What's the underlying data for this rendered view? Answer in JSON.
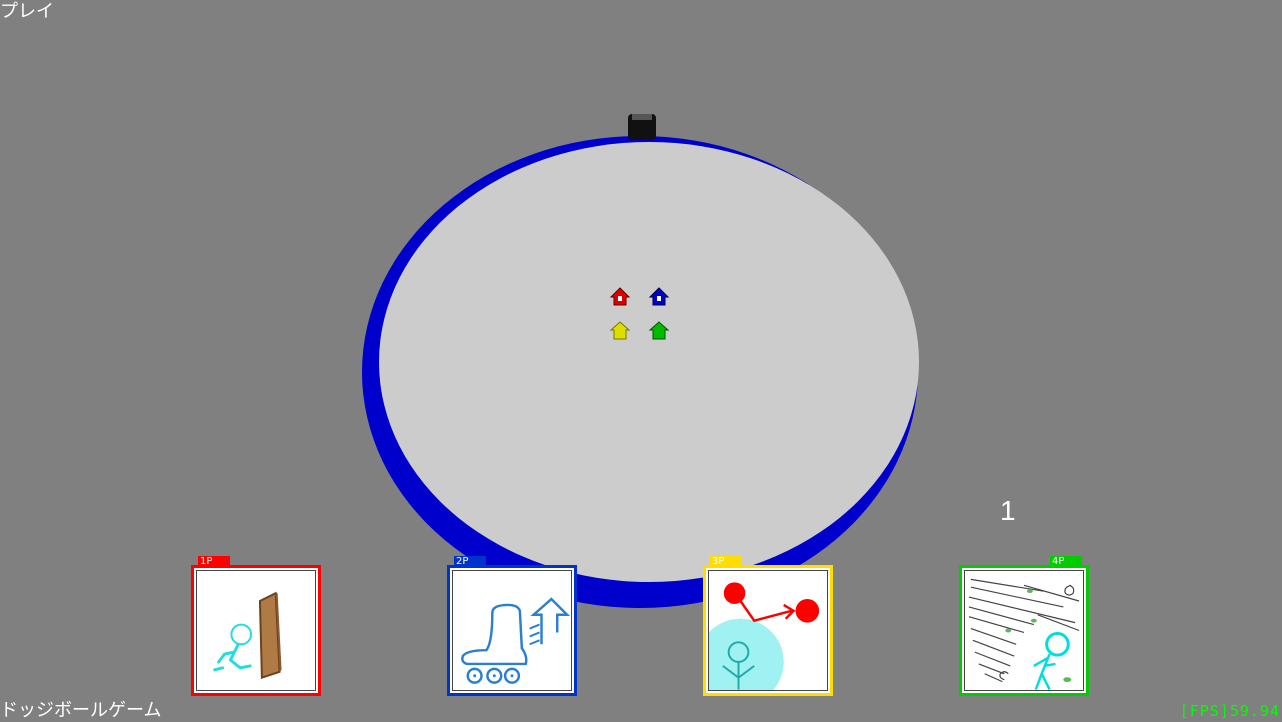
{
  "screen": {
    "mode_label": "プレイ",
    "game_title": "ドッジボールゲーム",
    "fps_text": "[FPS]59.94"
  },
  "counter": "1",
  "players": [
    {
      "tag": "1P",
      "color": "#ff0000",
      "skill_icon": "wall-icon"
    },
    {
      "tag": "2P",
      "color": "#0033cc",
      "skill_icon": "roller-skate-speed-icon"
    },
    {
      "tag": "3P",
      "color": "#ffdd00",
      "skill_icon": "ball-redirect-icon"
    },
    {
      "tag": "4P",
      "color": "#00cc00",
      "skill_icon": "wind-icon"
    }
  ],
  "arena": {
    "ring_color": "#0000cc",
    "floor_color": "#cccccc"
  }
}
